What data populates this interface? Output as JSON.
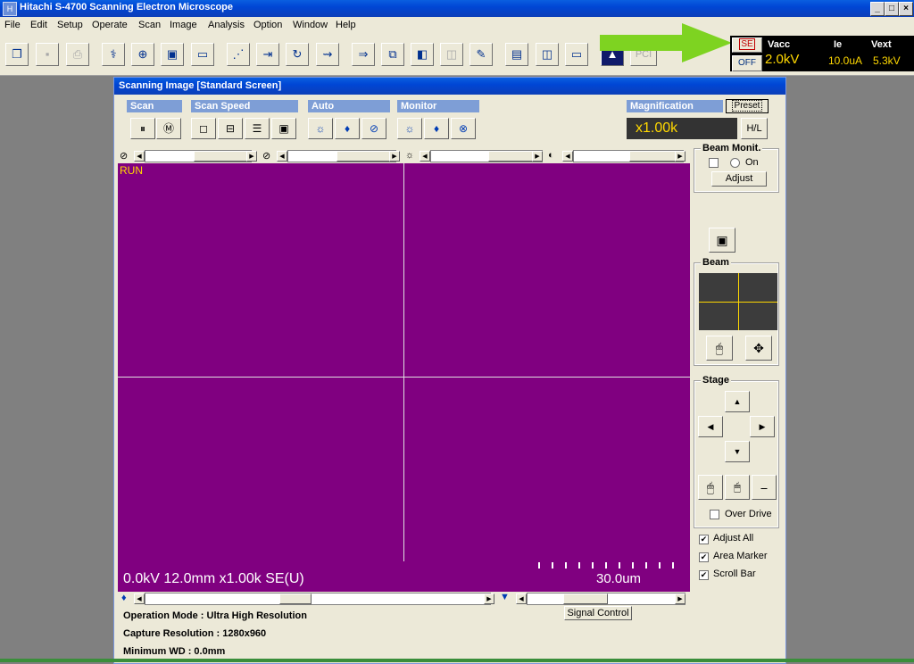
{
  "window": {
    "title": "Hitachi S-4700 Scanning Electron Microscope",
    "min": "_",
    "max": "□",
    "close": "×"
  },
  "menu": [
    "File",
    "Edit",
    "Setup",
    "Operate",
    "Scan",
    "Image",
    "Analysis",
    "Option",
    "Window",
    "Help"
  ],
  "toolbar": {
    "pci_label": "PCI"
  },
  "status": {
    "se_label": "SE",
    "off_label": "OFF",
    "vacc_label": "Vacc",
    "vacc_value": "2.0kV",
    "ie_label": "Ie",
    "ie_value": "10.0uA",
    "vext_label": "Vext",
    "vext_value": "5.3kV"
  },
  "child": {
    "title": "Scanning Image [Standard Screen]",
    "groups": {
      "scan": "Scan",
      "scan_speed": "Scan Speed",
      "auto": "Auto",
      "monitor": "Monitor",
      "magnification": "Magnification"
    },
    "preset_label": "Preset",
    "mag_value": "x1.00k",
    "hl_label": "H/L",
    "image": {
      "run_label": "RUN",
      "info": "0.0kV 12.0mm x1.00k SE(U)",
      "scale": "30.0um"
    },
    "beam_monit": {
      "title": "Beam Monit.",
      "on_label": "On",
      "adjust_label": "Adjust"
    },
    "beam": {
      "title": "Beam"
    },
    "stage": {
      "title": "Stage",
      "over_drive_label": "Over Drive"
    },
    "options": {
      "adjust_all": "Adjust All",
      "area_marker": "Area Marker",
      "scroll_bar": "Scroll Bar"
    },
    "signal_control_label": "Signal Control",
    "operation_mode": "Operation Mode : Ultra High Resolution",
    "capture_resolution": "Capture Resolution : 1280x960",
    "minimum_wd": "Minimum WD : 0.0mm"
  },
  "colors": {
    "image_bg": "#800080",
    "readout": "#ffd800",
    "arrow": "#7ed321"
  }
}
